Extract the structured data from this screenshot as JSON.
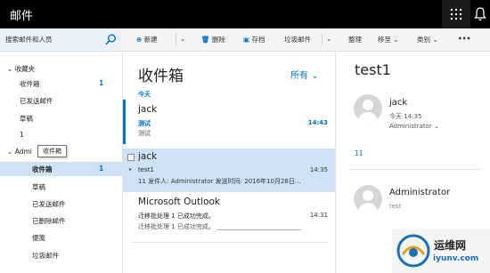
{
  "app": {
    "title": "邮件"
  },
  "search": {
    "placeholder": "搜索邮件和人员"
  },
  "commands": {
    "new": "新建",
    "delete": "删除",
    "archive": "存档",
    "junk": "垃圾邮件",
    "sweep": "整理",
    "move": "移至",
    "categorize": "类别",
    "more": "•••"
  },
  "folders": {
    "favorites_header": "收藏夹",
    "favorites": [
      {
        "label": "收件箱",
        "count": "1"
      },
      {
        "label": "已发送邮件",
        "count": ""
      },
      {
        "label": "草稿",
        "count": ""
      },
      {
        "label": "1",
        "count": ""
      }
    ],
    "account_header": "Admi",
    "account_items": [
      {
        "label": "收件箱",
        "count": "1"
      },
      {
        "label": "草稿",
        "count": ""
      },
      {
        "label": "已发送邮件",
        "count": ""
      },
      {
        "label": "已删除邮件",
        "count": ""
      },
      {
        "label": "便笺",
        "count": ""
      },
      {
        "label": "垃圾邮件",
        "count": ""
      }
    ],
    "tooltip": "收件箱"
  },
  "list": {
    "title": "收件箱",
    "filter": "所有",
    "group_label": "今天",
    "messages": [
      {
        "sender": "jack",
        "subject": "测试",
        "preview": "测试",
        "time": "14:43",
        "unread": true,
        "selected": false
      },
      {
        "sender": "jack",
        "subject": "test1",
        "preview": "11 发件人: Administrator 发送时间: 2016年10月28日...",
        "time": "14:35",
        "unread": false,
        "selected": true
      },
      {
        "sender": "Microsoft Outlook",
        "subject": "迁移批处理 1 已成功完成。",
        "preview": "迁移批处理 1 已成功完成。 ___________________________",
        "time": "14:31",
        "unread": false,
        "selected": false
      }
    ]
  },
  "reading": {
    "subject": "test1",
    "first": {
      "sender": "jack",
      "date": "今天 14:35",
      "to": "Administrator",
      "body": "11"
    },
    "second": {
      "sender": "Administrator",
      "snippet": "test"
    }
  },
  "watermark": {
    "cn": "运维网",
    "url": "iyunv.com"
  },
  "colors": {
    "accent": "#0072c6",
    "selected_row": "#cfe2f5",
    "topbar": "#000000"
  }
}
